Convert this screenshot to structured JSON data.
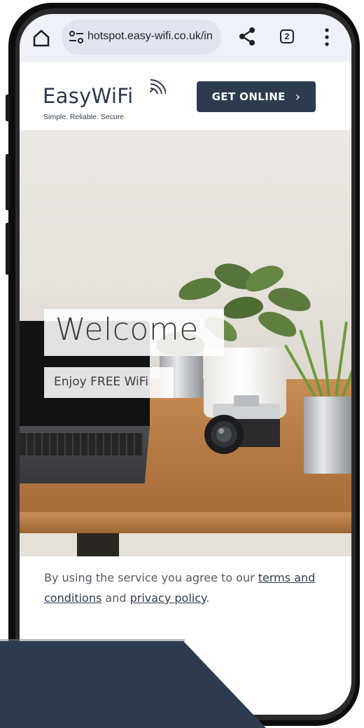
{
  "browser": {
    "url": "hotspot.easy-wifi.co.uk/in",
    "tab_count": "2",
    "icons": [
      "home-icon",
      "site-settings-icon",
      "share-icon",
      "tabs-icon",
      "more-vert-icon"
    ]
  },
  "header": {
    "logo_name": "EasyWiFi",
    "logo_tagline": "Simple. Reliable. Secure",
    "cta_label": "GET ONLINE",
    "cta_chevron": "›"
  },
  "hero": {
    "title": "Welcome",
    "subtitle": "Enjoy FREE WiFi"
  },
  "terms": {
    "prefix": "By using the service you agree to our ",
    "terms_link": "terms and conditions",
    "middle": " and ",
    "privacy_link": "privacy policy",
    "suffix": "."
  },
  "colors": {
    "brand_navy": "#2d3b50",
    "browser_bar": "#eef1f8",
    "url_pill": "#dfe4ef"
  }
}
